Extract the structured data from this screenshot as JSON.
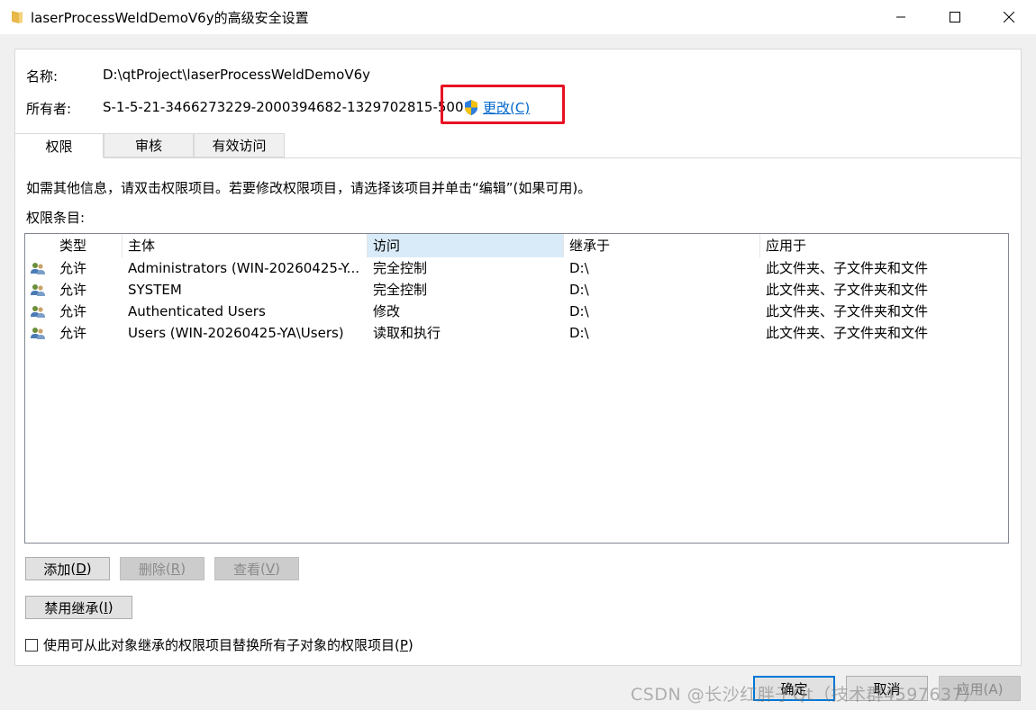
{
  "window": {
    "title": "laserProcessWeldDemoV6y的高级安全设置",
    "icons": {
      "folder": "folder-icon",
      "minimize": "minimize-icon",
      "maximize": "maximize-icon",
      "close": "close-icon"
    }
  },
  "header": {
    "name_label": "名称:",
    "name_value": "D:\\qtProject\\laserProcessWeldDemoV6y",
    "owner_label": "所有者:",
    "owner_value": "S-1-5-21-3466273229-2000394682-1329702815-500",
    "change_label": "更改(C)",
    "change_icon": "uac-shield-icon",
    "highlight_color": "#e81123"
  },
  "tabs": [
    {
      "label": "权限",
      "active": true
    },
    {
      "label": "审核",
      "active": false
    },
    {
      "label": "有效访问",
      "active": false
    }
  ],
  "info_text": "如需其他信息，请双击权限项目。若要修改权限项目，请选择该项目并单击“编辑”(如果可用)。",
  "entries_label": "权限条目:",
  "table": {
    "columns": [
      "类型",
      "主体",
      "访问",
      "继承于",
      "应用于"
    ],
    "rows": [
      {
        "type": "允许",
        "principal": "Administrators (WIN-20260425-Y...",
        "access": "完全控制",
        "inherited": "D:\\",
        "applies": "此文件夹、子文件夹和文件"
      },
      {
        "type": "允许",
        "principal": "SYSTEM",
        "access": "完全控制",
        "inherited": "D:\\",
        "applies": "此文件夹、子文件夹和文件"
      },
      {
        "type": "允许",
        "principal": "Authenticated Users",
        "access": "修改",
        "inherited": "D:\\",
        "applies": "此文件夹、子文件夹和文件"
      },
      {
        "type": "允许",
        "principal": "Users (WIN-20260425-YA\\Users)",
        "access": "读取和执行",
        "inherited": "D:\\",
        "applies": "此文件夹、子文件夹和文件"
      }
    ]
  },
  "buttons": {
    "add": {
      "label": "添加",
      "key": "D"
    },
    "remove": {
      "label": "删除",
      "key": "R"
    },
    "view": {
      "label": "查看",
      "key": "V"
    },
    "disable_inherit": {
      "label": "禁用继承",
      "key": "I"
    },
    "ok": "确定",
    "cancel": "取消",
    "apply": "应用(A)"
  },
  "checkbox": {
    "label": "使用可从此对象继承的权限项目替换所有子对象的权限项目",
    "key": "P",
    "checked": false
  },
  "watermark": "CSDN @长沙红胖子Qt（技术群4597637）"
}
